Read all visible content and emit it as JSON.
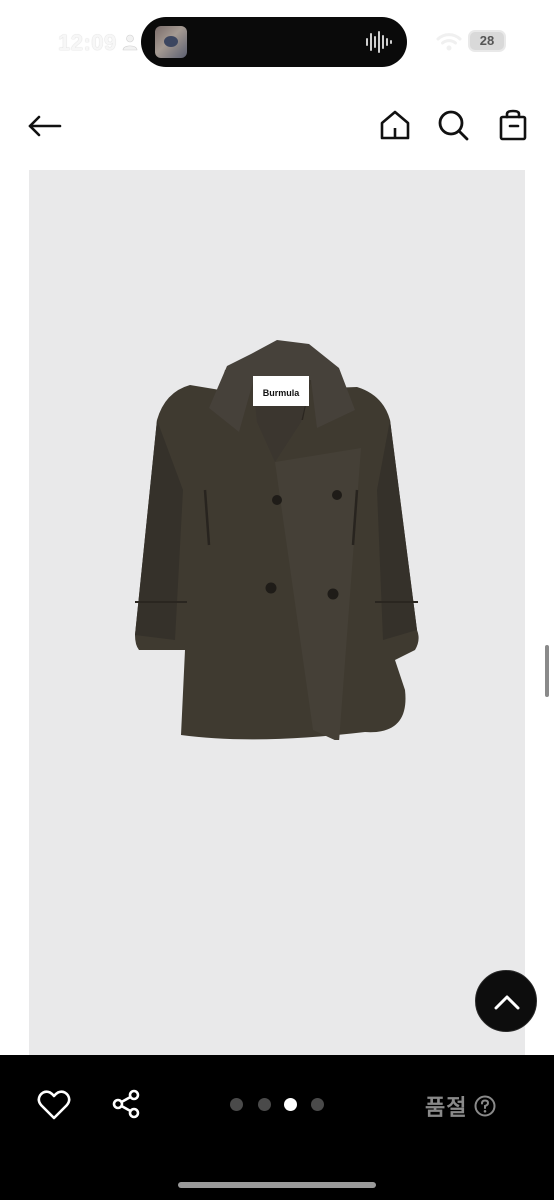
{
  "status_bar": {
    "time": "12:09",
    "battery": "28"
  },
  "header": {
    "back_icon": "back-arrow-icon",
    "home_icon": "home-icon",
    "search_icon": "search-icon",
    "bag_icon": "shopping-bag-icon"
  },
  "product": {
    "brand_label": "Burmula",
    "image_count": 4,
    "active_image_index": 3
  },
  "bottom_bar": {
    "status_label": "품절"
  },
  "colors": {
    "header_bg": "#ffffff",
    "image_bg": "#e9e9ea",
    "coat": "#3f3a30",
    "bottom_bar_bg": "#000000",
    "sold_out_text": "#8a8a8a"
  }
}
